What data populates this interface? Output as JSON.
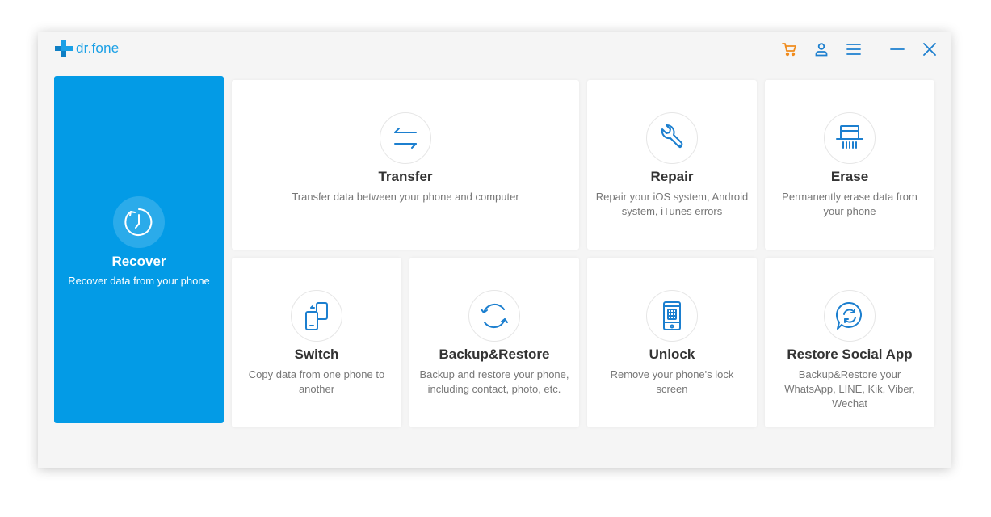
{
  "app": {
    "brand": "dr.fone",
    "colors": {
      "accent": "#039be6",
      "cart": "#f08c1e",
      "icon": "#1c7fcf"
    }
  },
  "header": {
    "icons": [
      "cart-icon",
      "user-icon",
      "menu-icon",
      "minimize-icon",
      "close-icon"
    ]
  },
  "recover": {
    "title": "Recover",
    "desc": "Recover data from your phone",
    "icon": "clock-icon"
  },
  "cards": {
    "transfer": {
      "title": "Transfer",
      "desc": [
        "Transfer data between your phone and computer"
      ],
      "icon": "transfer-arrows-icon"
    },
    "repair": {
      "title": "Repair",
      "desc": [
        "Repair your iOS system, Android",
        "system, iTunes errors"
      ],
      "icon": "wrench-icon"
    },
    "erase": {
      "title": "Erase",
      "desc": [
        "Permanently erase data from",
        "your phone"
      ],
      "icon": "shredder-icon"
    },
    "switch": {
      "title": "Switch",
      "desc": [
        "Copy data from one phone to",
        "another"
      ],
      "icon": "phone-switch-icon"
    },
    "backup": {
      "title": "Backup&Restore",
      "desc": [
        "Backup and restore your phone,",
        "including contact, photo, etc."
      ],
      "icon": "sync-icon"
    },
    "unlock": {
      "title": "Unlock",
      "desc": [
        "Remove your phone's lock",
        "screen"
      ],
      "icon": "phone-unlock-icon"
    },
    "social": {
      "title": "Restore Social App",
      "desc": [
        "Backup&Restore your",
        "WhatsApp, LINE, Kik, Viber,",
        "Wechat"
      ],
      "icon": "chat-sync-icon"
    }
  }
}
